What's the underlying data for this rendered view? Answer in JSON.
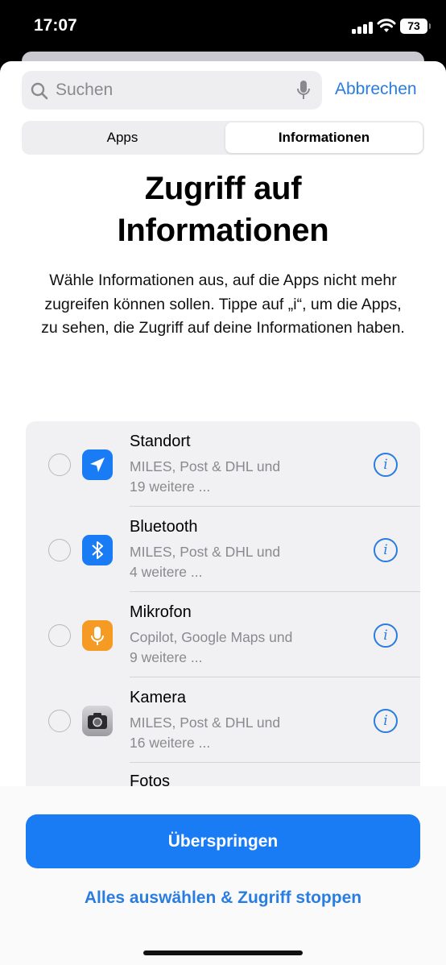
{
  "status_bar": {
    "time": "17:07",
    "battery": "73"
  },
  "search": {
    "placeholder": "Suchen",
    "cancel_label": "Abbrechen"
  },
  "segments": {
    "apps": "Apps",
    "information": "Informationen"
  },
  "title": "Zugriff auf Informationen",
  "description": "Wähle Informationen aus, auf die Apps nicht mehr zugreifen können sollen. Tippe auf „i“, um die Apps, zu sehen, die Zugriff auf deine Informationen haben.",
  "items": [
    {
      "title": "Standort",
      "line1": "MILES, Post & DHL und",
      "line2": "19 weitere ...",
      "icon": "location-arrow-icon",
      "icon_color": "#1a7cf5"
    },
    {
      "title": "Bluetooth",
      "line1": "MILES, Post & DHL und",
      "line2": "4 weitere ...",
      "icon": "bluetooth-icon",
      "icon_color": "#1a7cf5"
    },
    {
      "title": "Mikrofon",
      "line1": "Copilot, Google Maps und",
      "line2": "9 weitere ...",
      "icon": "microphone-icon",
      "icon_color": "#f59a23"
    },
    {
      "title": "Kamera",
      "line1": "MILES, Post & DHL und",
      "line2": "16 weitere ...",
      "icon": "camera-icon",
      "icon_color": "#8e8e93"
    },
    {
      "title": "Fotos"
    }
  ],
  "info_glyph": "i",
  "buttons": {
    "skip": "Überspringen",
    "select_all": "Alles auswählen & Zugriff stoppen"
  },
  "colors": {
    "accent": "#2a7de0",
    "primary_button": "#1a7cf5"
  }
}
